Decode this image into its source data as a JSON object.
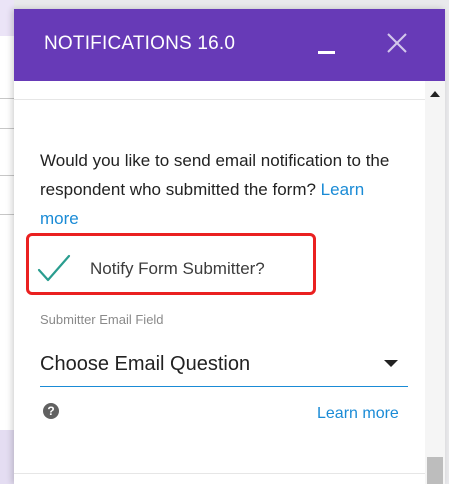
{
  "header": {
    "title": "NOTIFICATIONS 16.0",
    "minimize_icon": "minimize-icon",
    "close_icon": "close-icon"
  },
  "notification": {
    "question_text": "Would you like to send email notification to the respondent who submitted the form?",
    "question_link": "Learn more",
    "checkbox_label": "Notify Form Submitter?",
    "checkbox_checked": true,
    "field_label": "Submitter Email Field",
    "select_value": "Choose Email Question",
    "help_icon": "help-icon",
    "bottom_link": "Learn more"
  },
  "colors": {
    "header_bg": "#673ab7",
    "link": "#1a8bd6",
    "check": "#2a9d8f",
    "highlight": "#ea2020"
  }
}
